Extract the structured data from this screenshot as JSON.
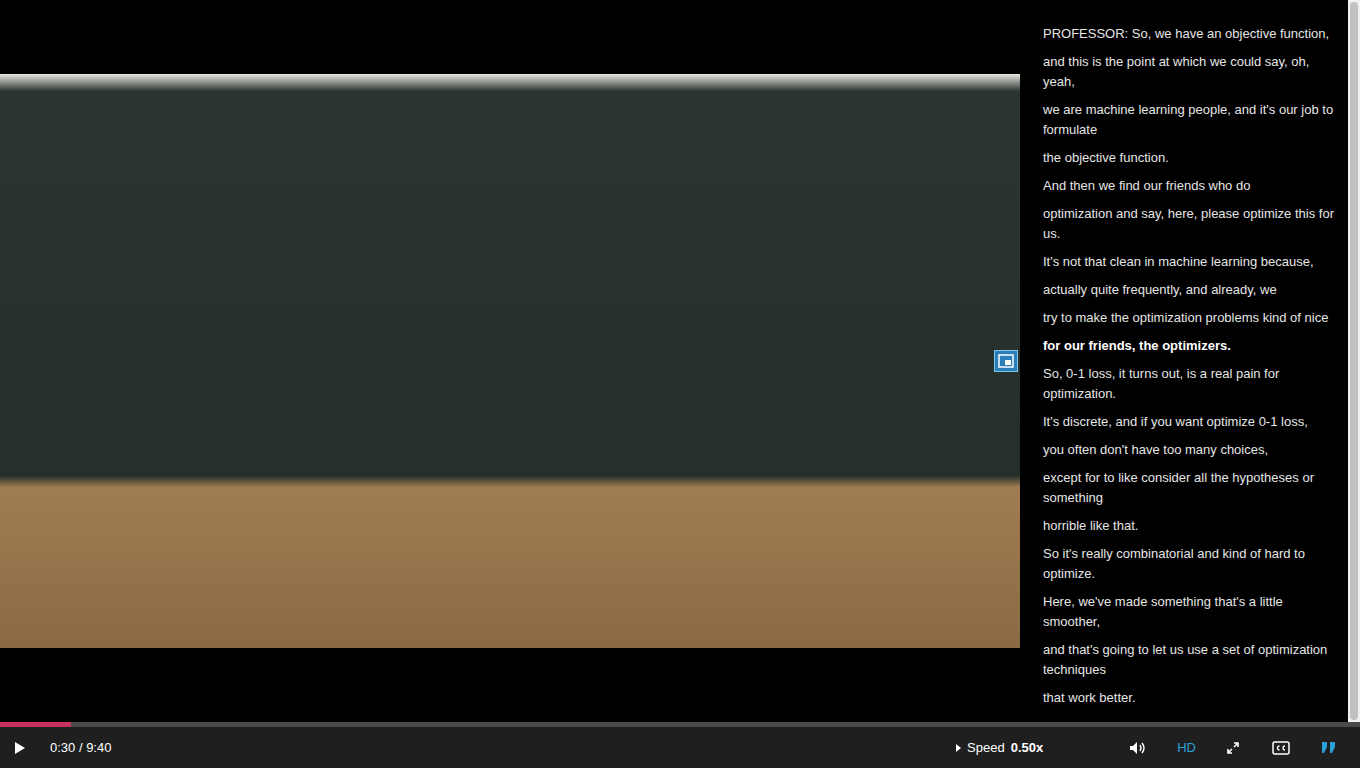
{
  "video": {
    "playing": false
  },
  "transcript": {
    "lines": [
      {
        "text": "PROFESSOR: So, we have an objective function,",
        "selected": false
      },
      {
        "text": "and this is the point at which we could say, oh, yeah,",
        "selected": false
      },
      {
        "text": "we are machine learning people, and it's our job to formulate",
        "selected": false
      },
      {
        "text": "the objective function.",
        "selected": false
      },
      {
        "text": "And then we find our friends who do",
        "selected": false
      },
      {
        "text": "optimization and say, here, please optimize this for us.",
        "selected": false
      },
      {
        "text": "It's not that clean in machine learning because,",
        "selected": false
      },
      {
        "text": "actually quite frequently, and already, we",
        "selected": false
      },
      {
        "text": "try to make the optimization problems kind of nice",
        "selected": false
      },
      {
        "text": "for our friends, the optimizers.",
        "selected": true
      },
      {
        "text": "So, 0-1 loss, it turns out, is a real pain for optimization.",
        "selected": false
      },
      {
        "text": "It's discrete, and if you want optimize 0-1 loss,",
        "selected": false
      },
      {
        "text": "you often don't have too many choices,",
        "selected": false
      },
      {
        "text": "except for to like consider all the hypotheses or something",
        "selected": false
      },
      {
        "text": "horrible like that.",
        "selected": false
      },
      {
        "text": "So it's really combinatorial and kind of hard to optimize.",
        "selected": false
      },
      {
        "text": "Here, we've made something that's a little smoother,",
        "selected": false
      },
      {
        "text": "and that's going to let us use a set of optimization techniques",
        "selected": false
      },
      {
        "text": "that work better.",
        "selected": false
      }
    ]
  },
  "progress": {
    "level": 0.052
  },
  "controls": {
    "time": "0:30 / 9:40",
    "speed_label": "Speed",
    "speed_value": "0.50x",
    "hd": {
      "label": "HD",
      "on": true
    },
    "captions_on": false,
    "transcript_on": true
  }
}
